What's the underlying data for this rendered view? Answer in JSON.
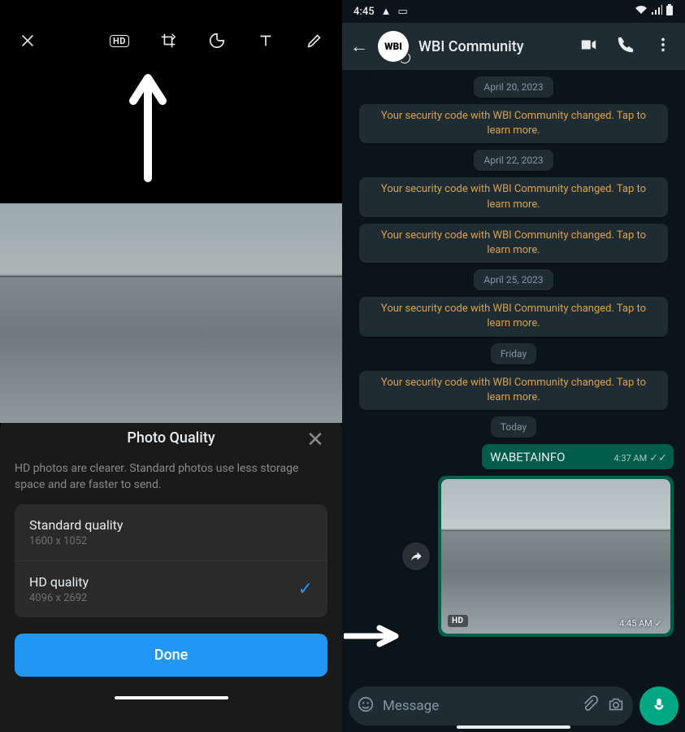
{
  "left": {
    "toolbar": {
      "hd_label": "HD"
    },
    "sheet": {
      "title": "Photo Quality",
      "description": "HD photos are clearer. Standard photos use less storage space and are faster to send.",
      "options": [
        {
          "label": "Standard quality",
          "sub": "1600 x 1052",
          "selected": false
        },
        {
          "label": "HD quality",
          "sub": "4096 x 2692",
          "selected": true
        }
      ],
      "done": "Done"
    }
  },
  "right": {
    "status": {
      "time": "4:45"
    },
    "header": {
      "avatar_text": "WBI",
      "title": "WBI Community"
    },
    "chat": {
      "security_text": "Your security code with WBI Community changed. Tap to learn more.",
      "dates": {
        "d1": "April 20, 2023",
        "d2": "April 22, 2023",
        "d3": "April 25, 2023",
        "d4": "Friday",
        "d5": "Today"
      },
      "msg_text": "WABETAINFO",
      "msg_time": "4:37 AM",
      "photo_time": "4:45 AM",
      "hd_tag": "HD"
    },
    "input": {
      "placeholder": "Message"
    }
  }
}
